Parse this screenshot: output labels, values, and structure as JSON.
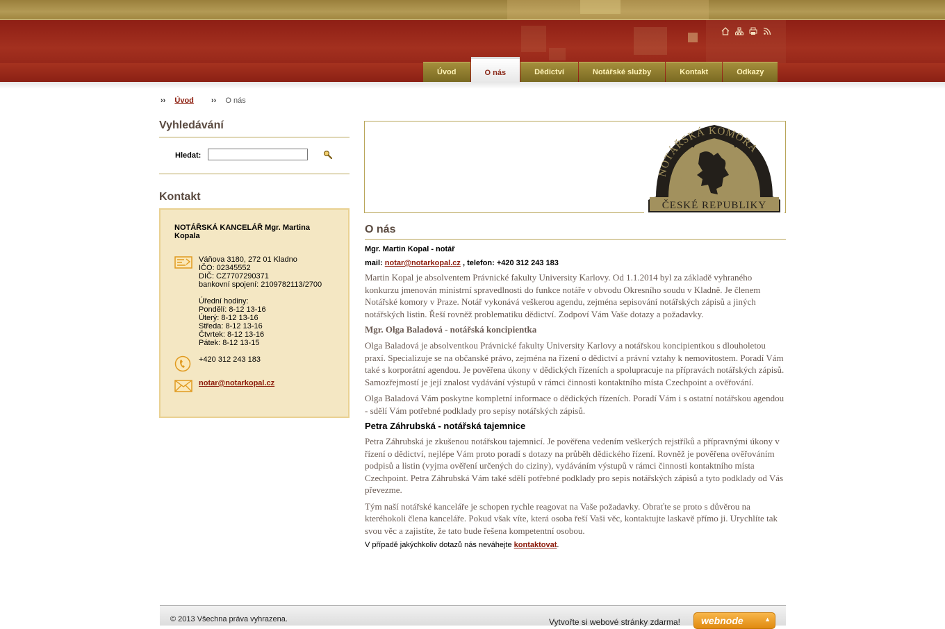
{
  "header": {
    "icons": [
      "home-icon",
      "sitemap-icon",
      "print-icon",
      "rss-icon"
    ]
  },
  "nav": {
    "tabs": [
      {
        "label": "Úvod",
        "active": false
      },
      {
        "label": "O nás",
        "active": true
      },
      {
        "label": "Dědictví",
        "active": false
      },
      {
        "label": "Notářské služby",
        "active": false
      },
      {
        "label": "Kontakt",
        "active": false
      },
      {
        "label": "Odkazy",
        "active": false
      }
    ]
  },
  "breadcrumb": {
    "sep": "››",
    "home": "Úvod",
    "current": "O nás"
  },
  "search": {
    "title": "Vyhledávání",
    "label": "Hledat:",
    "value": ""
  },
  "contact": {
    "title": "Kontakt",
    "org": "NOTÁŘSKÁ KANCELÁŘ Mgr. Martina Kopala",
    "address_lines": [
      "Váňova 3180, 272 01 Kladno",
      "IČO: 02345552",
      "DIČ: CZ7707290371",
      "bankovní spojení: 2109782113/2700",
      "",
      "Úřední hodiny:",
      "Pondělí: 8-12 13-16",
      "Úterý: 8-12 13-16",
      "Středa: 8-12 13-16",
      "Čtvrtek: 8-12 13-16",
      "Pátek: 8-12 13-15"
    ],
    "phone": "+420 312 243 183",
    "email": "notar@notarkopal.cz"
  },
  "banner": {
    "logo_top": "NOTÁŘSKÁ KOMORA",
    "logo_bottom": "ČESKÉ REPUBLIKY",
    "colors": {
      "gold": "#a2915e",
      "dark": "#231f1a"
    }
  },
  "main": {
    "title": "O nás",
    "intro_name": "Mgr. Martin Kopal - notář",
    "mail_label": "mail:",
    "mail": "notar@notarkopal.cz",
    "phone_label": ", telefon: +420 312 243 183",
    "p1": "Martin Kopal je absolventem Právnické fakulty University Karlovy. Od 1.1.2014 byl za základě vyhraného konkurzu jmenován ministrní spravedlnosti do funkce notáře v obvodu Okresního soudu v Kladně. Je členem Notářské komory v Praze. Notář vykonává veškerou agendu, zejména sepisování notářských zápisů a jiných notářských listin. Řeší rovněž problematiku dědictví. Zodpoví Vám Vaše dotazy a požadavky.",
    "h_olga": "Mgr. Olga Baladová - notářská koncipientka",
    "p2": "Olga Baladová je absolventkou Právnické fakulty University Karlovy a notářskou koncipientkou s dlouholetou praxí. Specializuje se na občanské právo, zejména na řízení o dědictví a právní vztahy k nemovitostem. Poradí Vám také s korporátní agendou. Je pověřena úkony v dědických řízeních a spolupracuje na přípravách notářských zápisů. Samozřejmostí je její znalost vydávání výstupů v rámci činnosti kontaktního místa Czechpoint a ověřování.",
    "p3": "Olga Baladová Vám poskytne kompletní informace o dědických řízeních. Poradí Vám i s ostatní notářskou agendou - sdělí Vám potřebné podklady pro sepisy notářských zápisů.",
    "h_petra": "Petra Záhrubská - notářská tajemnice",
    "p4": "Petra Záhrubská je zkušenou notářskou tajemnicí. Je pověřena vedením veškerých rejstříků a přípravnými úkony v řízení o dědictví, nejlépe Vám proto poradí s dotazy na průběh dědického řízení. Rovněž je pověřena ověřováním podpisů a listin (vyjma ověření určených do ciziny), vydáváním výstupů v rámci činnosti kontaktního místa Czechpoint. Petra Záhrubská Vám také sdělí potřebné podklady pro sepis notářských zápisů a tyto podklady od Vás převezme.",
    "p5": "Tým naší notářské kanceláře je schopen rychle reagovat na Vaše požadavky. Obraťte se proto s důvěrou na kteréhokoli člena kanceláře. Pokud však víte, která osoba řeší Vaši věc, kontaktujte laskavě přímo ji. Urychlíte tak svou věc a zajistíte, že tato bude řešena kompetentní osobou.",
    "last_text": "V případě jakýchkoliv dotazů nás neváhejte ",
    "last_link": "kontaktovat",
    "last_end": "."
  },
  "footer": {
    "copyright": "© 2013 Všechna práva vyhrazena.",
    "promo": "Vytvořte si webové stránky zdarma!",
    "brand": "webnode"
  }
}
